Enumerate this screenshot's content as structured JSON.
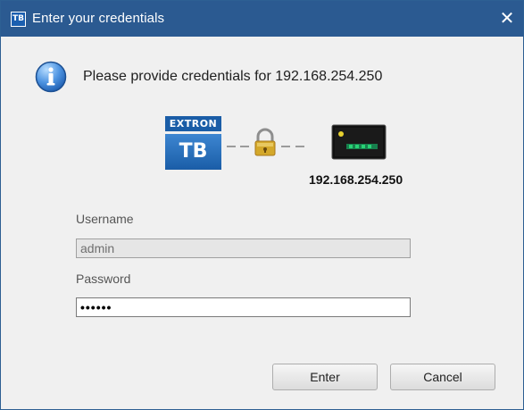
{
  "window": {
    "title": "Enter your credentials",
    "app_icon_text": "TB",
    "close_glyph": "✕"
  },
  "message": {
    "text": "Please provide credentials for 192.168.254.250",
    "icon": "info-icon"
  },
  "connection": {
    "source_logo_top": "EXTRON",
    "source_logo_bottom": "TB",
    "lock_icon": "lock-icon",
    "device_icon": "device-icon",
    "device_label": "192.168.254.250"
  },
  "form": {
    "username_label": "Username",
    "username_value": "admin",
    "password_label": "Password",
    "password_value": "••••••"
  },
  "buttons": {
    "enter_label": "Enter",
    "cancel_label": "Cancel"
  },
  "colors": {
    "titlebar": "#2b5a91",
    "window_background": "#f0f0f0",
    "extron_blue": "#1a5da7",
    "lock_gold": "#d4a82a"
  }
}
